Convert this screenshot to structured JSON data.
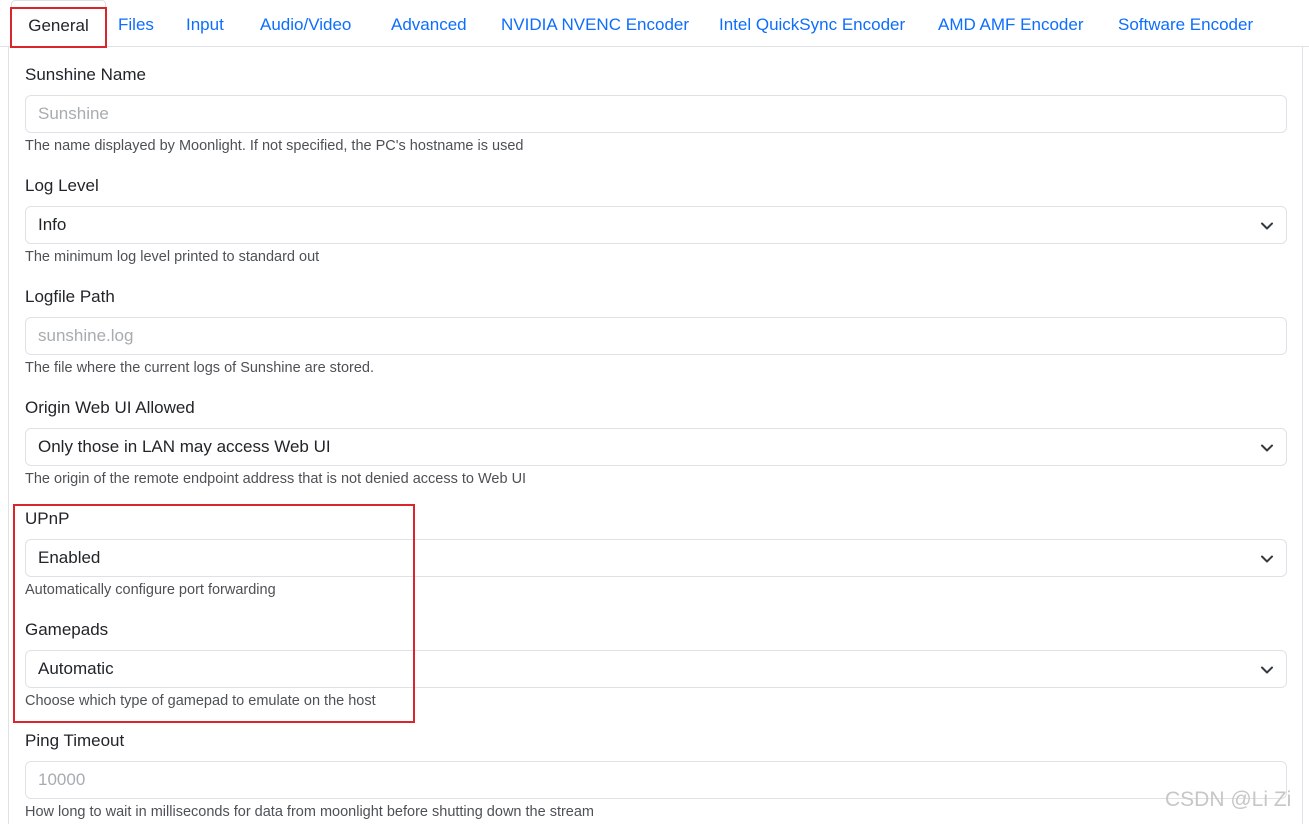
{
  "tabs": [
    {
      "label": "General",
      "active": true
    },
    {
      "label": "Files"
    },
    {
      "label": "Input"
    },
    {
      "label": "Audio/Video"
    },
    {
      "label": "Advanced"
    },
    {
      "label": "NVIDIA NVENC Encoder"
    },
    {
      "label": "Intel QuickSync Encoder"
    },
    {
      "label": "AMD AMF Encoder"
    },
    {
      "label": "Software Encoder"
    }
  ],
  "fields": {
    "sunshine_name": {
      "label": "Sunshine Name",
      "placeholder": "Sunshine",
      "help": "The name displayed by Moonlight. If not specified, the PC's hostname is used"
    },
    "log_level": {
      "label": "Log Level",
      "value": "Info",
      "help": "The minimum log level printed to standard out"
    },
    "logfile_path": {
      "label": "Logfile Path",
      "placeholder": "sunshine.log",
      "help": "The file where the current logs of Sunshine are stored."
    },
    "origin_web_ui": {
      "label": "Origin Web UI Allowed",
      "value": "Only those in LAN may access Web UI",
      "help": "The origin of the remote endpoint address that is not denied access to Web UI"
    },
    "upnp": {
      "label": "UPnP",
      "value": "Enabled",
      "help": "Automatically configure port forwarding"
    },
    "gamepads": {
      "label": "Gamepads",
      "value": "Automatic",
      "help": "Choose which type of gamepad to emulate on the host"
    },
    "ping_timeout": {
      "label": "Ping Timeout",
      "placeholder": "10000",
      "help": "How long to wait in milliseconds for data from moonlight before shutting down the stream"
    }
  },
  "watermark": "CSDN @Li Zi",
  "colors": {
    "link": "#0d6efd",
    "highlight": "#d9262c",
    "border": "#dee2e6",
    "placeholder": "#a7acb1"
  }
}
